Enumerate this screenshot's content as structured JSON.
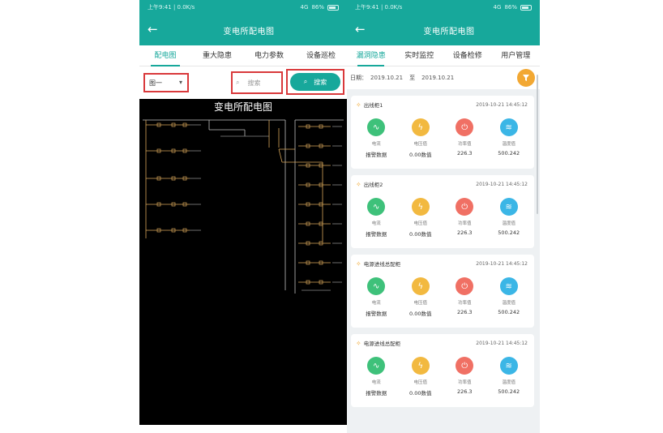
{
  "left": {
    "status": {
      "time": "上午9:41 | 0.0K/s",
      "signal": "4G",
      "battery": "86%"
    },
    "title": "变电所配电图",
    "tabs": [
      "配电图",
      "重大隐患",
      "电力参数",
      "设备巡检"
    ],
    "select": {
      "value": "图一",
      "options": [
        "图一"
      ]
    },
    "search": {
      "placeholder": "搜索"
    },
    "search_button": "搜索",
    "diagram": {
      "title": "变电所配电图",
      "line_color": "#d8a75a",
      "frame_color": "#bfbfbf"
    }
  },
  "right": {
    "status": {
      "time": "上午9:41 | 0.0K/s",
      "signal": "4G",
      "battery": "86%"
    },
    "title": "变电所配电图",
    "tabs": [
      "漏洞隐患",
      "实时监控",
      "设备检修",
      "用户管理"
    ],
    "date": {
      "label": "日期：",
      "start": "2019.10.21",
      "separator": "至",
      "end": "2019.10.21"
    },
    "cards": [
      {
        "title": "出线柜1",
        "time": "2019-10-21 14:45:12",
        "items": [
          {
            "label": "电流",
            "value": "报警数据",
            "color": "#3ec17a",
            "icon": "pulse-icon"
          },
          {
            "label": "电压值",
            "value": "0.00数值",
            "color": "#f2b940",
            "icon": "bolt-icon"
          },
          {
            "label": "功率值",
            "value": "226.3",
            "color": "#f07064",
            "icon": "power-icon"
          },
          {
            "label": "温度值",
            "value": "500.242",
            "color": "#3bb6e6",
            "icon": "thermo-icon"
          }
        ]
      },
      {
        "title": "出线柜2",
        "time": "2019-10-21 14:45:12",
        "items": [
          {
            "label": "电流",
            "value": "报警数据",
            "color": "#3ec17a",
            "icon": "pulse-icon"
          },
          {
            "label": "电压值",
            "value": "0.00数值",
            "color": "#f2b940",
            "icon": "bolt-icon"
          },
          {
            "label": "功率值",
            "value": "226.3",
            "color": "#f07064",
            "icon": "power-icon"
          },
          {
            "label": "温度值",
            "value": "500.242",
            "color": "#3bb6e6",
            "icon": "thermo-icon"
          }
        ]
      },
      {
        "title": "电源进线总配柜",
        "time": "2019-10-21 14:45:12",
        "items": [
          {
            "label": "电流",
            "value": "报警数据",
            "color": "#3ec17a",
            "icon": "pulse-icon"
          },
          {
            "label": "电压值",
            "value": "0.00数值",
            "color": "#f2b940",
            "icon": "bolt-icon"
          },
          {
            "label": "功率值",
            "value": "226.3",
            "color": "#f07064",
            "icon": "power-icon"
          },
          {
            "label": "温度值",
            "value": "500.242",
            "color": "#3bb6e6",
            "icon": "thermo-icon"
          }
        ]
      },
      {
        "title": "电源进线总配柜",
        "time": "2019-10-21 14:45:12",
        "items": [
          {
            "label": "电流",
            "value": "报警数据",
            "color": "#3ec17a",
            "icon": "pulse-icon"
          },
          {
            "label": "电压值",
            "value": "0.00数值",
            "color": "#f2b940",
            "icon": "bolt-icon"
          },
          {
            "label": "功率值",
            "value": "226.3",
            "color": "#f07064",
            "icon": "power-icon"
          },
          {
            "label": "温度值",
            "value": "500.242",
            "color": "#3bb6e6",
            "icon": "thermo-icon"
          }
        ]
      }
    ]
  },
  "colors": {
    "brand": "#17a89b",
    "highlight": "#d9393b",
    "accent": "#f2a833"
  }
}
